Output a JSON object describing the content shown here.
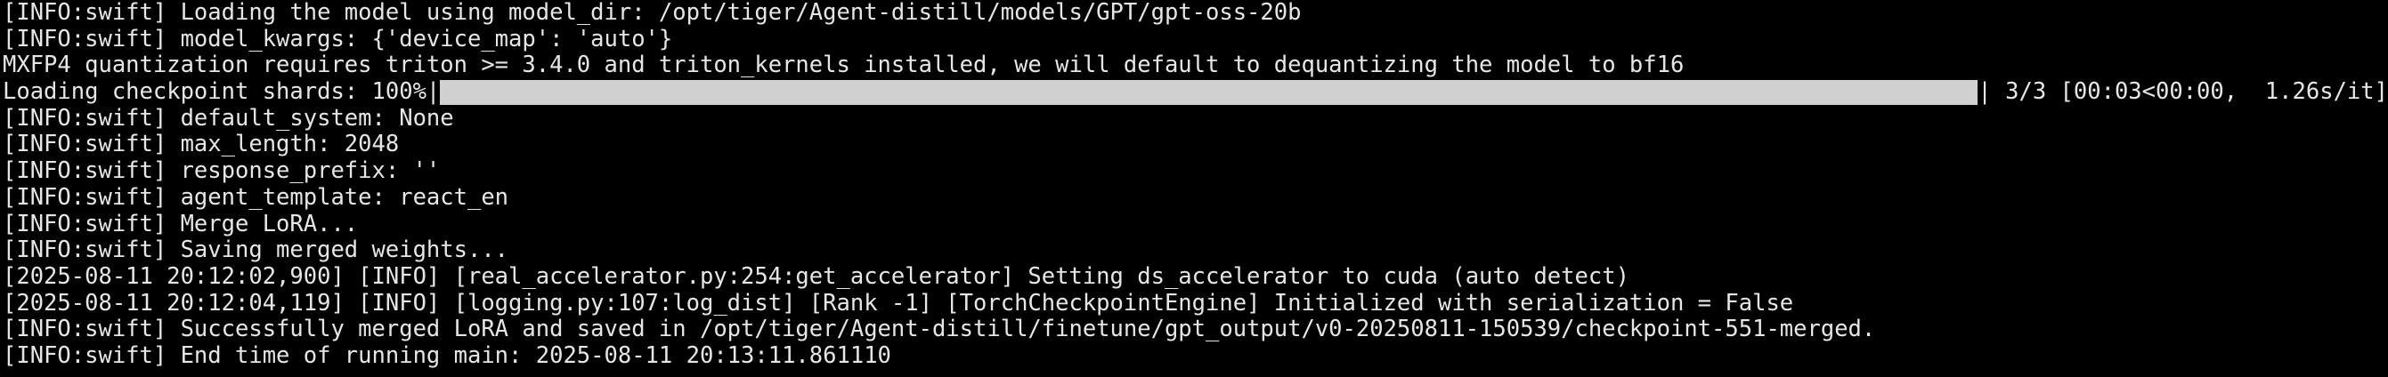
{
  "terminal": {
    "colors": {
      "background": "#000000",
      "text": "#e6e6e6",
      "progress_fill": "#d0d0d0"
    },
    "lines": [
      "[INFO:swift] Loading the model using model_dir: /opt/tiger/Agent-distill/models/GPT/gpt-oss-20b",
      "[INFO:swift] model_kwargs: {'device_map': 'auto'}",
      "MXFP4 quantization requires triton >= 3.4.0 and triton_kernels installed, we will default to dequantizing the model to bf16"
    ],
    "progress": {
      "prefix": "Loading checkpoint shards: 100%|",
      "suffix": "| 3/3 [00:03<00:00,  1.26s/it]",
      "fraction": 1.0
    },
    "lines_after": [
      "[INFO:swift] default_system: None",
      "[INFO:swift] max_length: 2048",
      "[INFO:swift] response_prefix: ''",
      "[INFO:swift] agent_template: react_en",
      "[INFO:swift] Merge LoRA...",
      "[INFO:swift] Saving merged weights...",
      "[2025-08-11 20:12:02,900] [INFO] [real_accelerator.py:254:get_accelerator] Setting ds_accelerator to cuda (auto detect)",
      "[2025-08-11 20:12:04,119] [INFO] [logging.py:107:log_dist] [Rank -1] [TorchCheckpointEngine] Initialized with serialization = False",
      "[INFO:swift] Successfully merged LoRA and saved in /opt/tiger/Agent-distill/finetune/gpt_output/v0-20250811-150539/checkpoint-551-merged.",
      "[INFO:swift] End time of running main: 2025-08-11 20:13:11.861110"
    ]
  }
}
